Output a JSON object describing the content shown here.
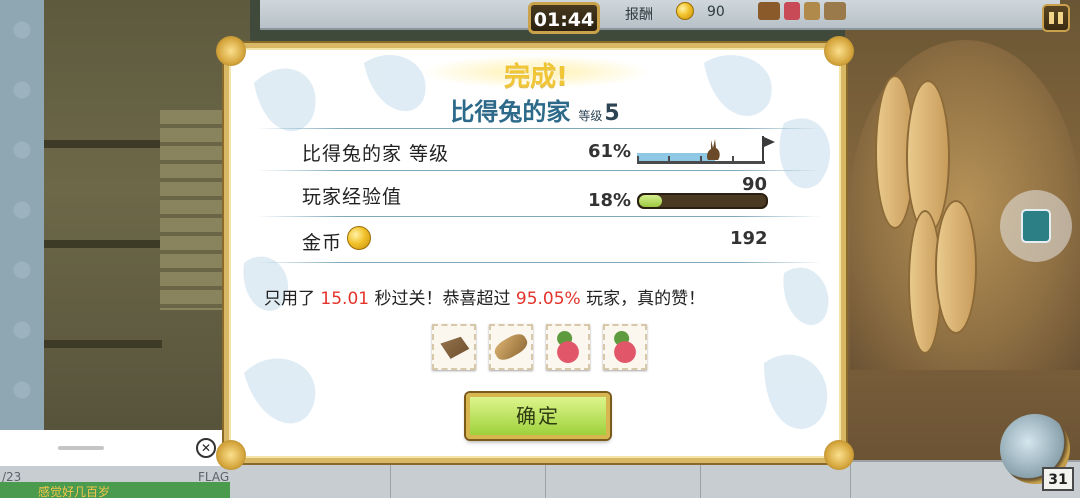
{
  "hud": {
    "timer": "01:44",
    "reward_label": "报酬",
    "reward_value": "90",
    "pause_icon": "pause-icon",
    "item_count": "31"
  },
  "result": {
    "title": "完成!",
    "level_name": "比得兔的家",
    "level_tag": "等级",
    "level_number": "5",
    "stats": {
      "level_label": "比得兔的家  等级",
      "level_percent": "61%",
      "level_progress": 0.61,
      "xp_label": "玩家经验值",
      "xp_percent": "18%",
      "xp_gain": "90",
      "xp_progress": 0.18,
      "coins_label": "金币",
      "coins_value": "192"
    },
    "message": {
      "prefix": "只用了 ",
      "time": "15.01",
      "middle": " 秒过关！恭喜超过 ",
      "percent": "95.05%",
      "suffix": " 玩家，真的赞！"
    },
    "rewards": [
      {
        "icon": "bark-icon"
      },
      {
        "icon": "log-icon"
      },
      {
        "icon": "radish-icon"
      },
      {
        "icon": "radish-icon"
      }
    ],
    "confirm_label": "确定"
  },
  "background": {
    "bar_left": "/23",
    "bar_flag": "FLAG",
    "chat_text": "感觉好几百岁"
  },
  "colors": {
    "highlight": "#e3332a",
    "title_gold": "#f0c636",
    "level_blue": "#2d6a8a",
    "button_green": "#9fd13c"
  }
}
